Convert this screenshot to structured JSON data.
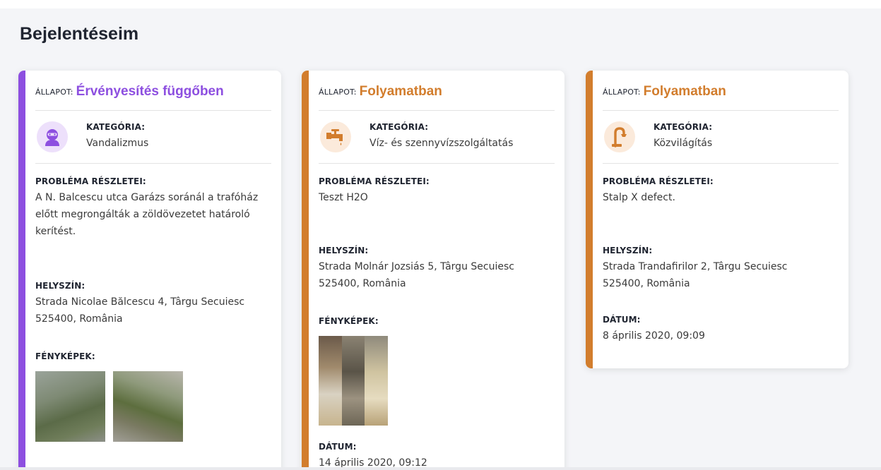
{
  "page": {
    "title": "Bejelentéseim"
  },
  "labels": {
    "status": "Állapot:",
    "category": "KATEGÓRIA:",
    "details": "PROBLÉMA RÉSZLETEI:",
    "location": "HELYSZÍN:",
    "photos": "FÉNYKÉPEK:",
    "date": "DÁTUM:"
  },
  "colors": {
    "pending": "#8d4fe0",
    "in_progress": "#d27d2d"
  },
  "cards": [
    {
      "status": "Érvényesítés függőben",
      "category": "Vandalizmus",
      "category_icon": "vandal-icon",
      "details": "A N. Balcescu utca Garázs soránál a trafóház előtt megrongálták a zöldövezetet határoló kerítést.",
      "location_line1": "Strada Nicolae Bălcescu 4, Târgu Secuiesc",
      "location_line2": "525400, România"
    },
    {
      "status": "Folyamatban",
      "category": "Víz- és szennyvízszolgáltatás",
      "category_icon": "water-tap-icon",
      "details": "Teszt H2O",
      "location_line1": "Strada Molnár Jozsiás 5, Târgu Secuiesc",
      "location_line2": "525400, România",
      "date": "14 április 2020, 09:12"
    },
    {
      "status": "Folyamatban",
      "category": "Közvilágítás",
      "category_icon": "street-lamp-icon",
      "details": "Stalp X defect.",
      "location_line1": "Strada Trandafirilor 2, Târgu Secuiesc",
      "location_line2": "525400, România",
      "date": "8 április 2020, 09:09"
    }
  ]
}
